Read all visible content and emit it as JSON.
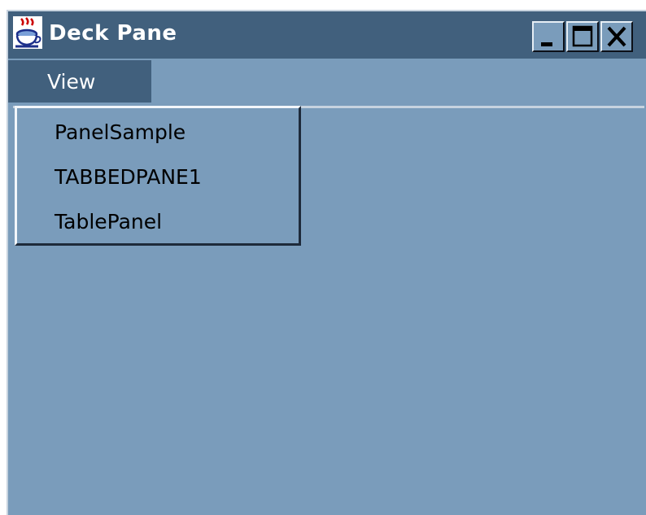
{
  "window": {
    "title": "Deck Pane",
    "app_icon": "java-cup-icon",
    "controls": {
      "minimize": "minimize-icon",
      "maximize": "maximize-icon",
      "close": "close-icon"
    }
  },
  "menubar": {
    "menus": [
      {
        "label": "View",
        "open": true
      }
    ]
  },
  "view_menu": {
    "items": [
      {
        "label": "PanelSample"
      },
      {
        "label": "TABBEDPANE1"
      },
      {
        "label": "TablePanel"
      }
    ]
  },
  "colors": {
    "titlebar": "#41607d",
    "background": "#7a9cbb",
    "menu_text": "#000000",
    "title_text": "#ffffff"
  }
}
